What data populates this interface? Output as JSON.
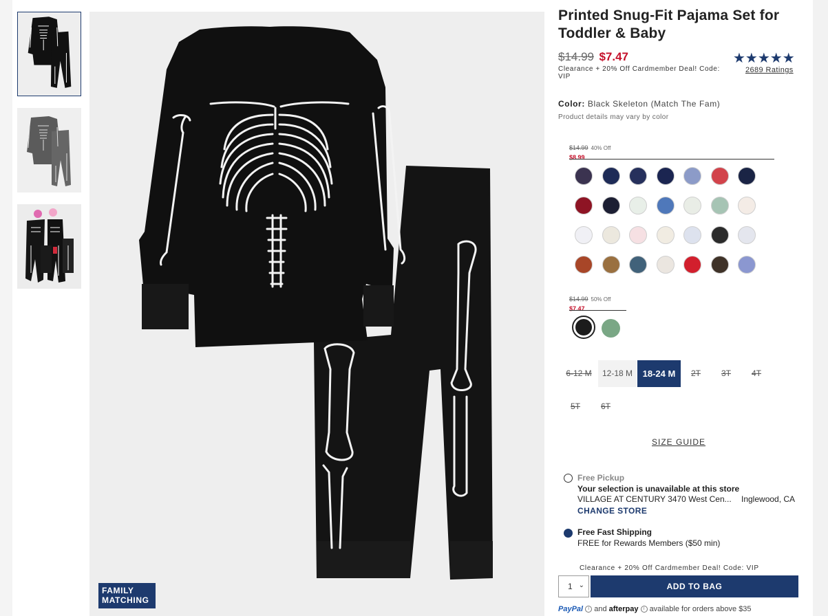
{
  "product": {
    "title": "Printed Snug-Fit Pajama Set for Toddler & Baby",
    "price_old": "$14.99",
    "price_new": "$7.47",
    "deal_note": "Clearance + 20% Off Cardmember Deal! Code: VIP",
    "stars": "★★★★★",
    "rating_fraction": 1.0,
    "ratings_text": "2689 Ratings"
  },
  "image": {
    "badge_line1": "FAMILY",
    "badge_line2": "MATCHING"
  },
  "color": {
    "label": "Color:",
    "value": "Black Skeleton (Match The Fam)",
    "note": "Product details may vary by color"
  },
  "tiers": [
    {
      "was": "$14.99",
      "off": "40% Off",
      "now": "$8.99"
    },
    {
      "was": "$14.99",
      "off": "50% Off",
      "now": "$7.47"
    }
  ],
  "swatch_colors": [
    "#3b3350",
    "#1e2b57",
    "#26305c",
    "#1b2551",
    "#8c9bc8",
    "#d2434b",
    "#1a2445",
    "#8e1424",
    "#1c1f33",
    "#e8efe8",
    "#4f78ba",
    "#e9ede6",
    "#a6c4b4",
    "#f4ece6",
    "#f0f0f5",
    "#ece8de",
    "#f6e0e3",
    "#f1ece2",
    "#dde2ee",
    "#2b2b2b",
    "#e4e6ee",
    "#a84628",
    "#9a7040",
    "#41627a",
    "#ebe6e0",
    "#d21f2d",
    "#3f3228",
    "#8b97d0"
  ],
  "selected_swatches": [
    "#1c1c1c",
    "#7aa785"
  ],
  "sizes": [
    {
      "label": "6-12 M"
    },
    {
      "label": "12-18 M"
    },
    {
      "label": "18-24 M"
    },
    {
      "label": "2T"
    },
    {
      "label": "3T"
    },
    {
      "label": "4T"
    },
    {
      "label": "5T"
    },
    {
      "label": "6T"
    }
  ],
  "size_guide": "SIZE GUIDE",
  "pickup": {
    "title": "Free Pickup",
    "status": "Your selection is unavailable at this store",
    "store": "VILLAGE AT CENTURY 3470 West Cen...",
    "city": "Inglewood, CA",
    "change": "CHANGE STORE"
  },
  "shipping": {
    "title": "Free Fast Shipping",
    "text": "FREE for Rewards Members ($50 min)"
  },
  "cart": {
    "deal_repeat": "Clearance + 20% Off Cardmember Deal! Code: VIP",
    "qty": "1",
    "add_label": "ADD TO BAG"
  },
  "payments": {
    "paypal": "PayPal",
    "and": "and",
    "afterpay": "afterpay",
    "text": "available for orders above $35"
  }
}
